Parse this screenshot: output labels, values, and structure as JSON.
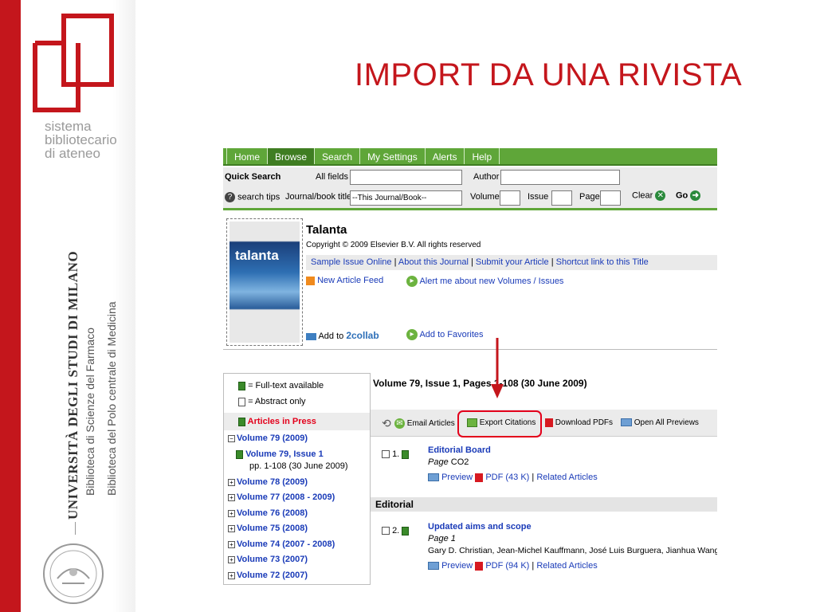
{
  "slide": {
    "title": "IMPORT DA UNA RIVISTA",
    "sistema_lines": [
      "sistema",
      "bibliotecario",
      "di ateneo"
    ],
    "university": "UNIVERSITÀ DEGLI STUDI DI MILANO",
    "library1": "Biblioteca di Scienze del Farmaco",
    "library2": "Biblioteca del Polo centrale di Medicina",
    "brand_red": "#c4161c"
  },
  "nav": {
    "tabs": [
      "Home",
      "Browse",
      "Search",
      "My Settings",
      "Alerts",
      "Help"
    ],
    "active": "Browse",
    "color": "#5fa639"
  },
  "search": {
    "quick_search": "Quick Search",
    "all_fields": "All fields",
    "author": "Author",
    "search_tips": "search tips",
    "journal_label": "Journal/book title",
    "journal_value": "--This Journal/Book--",
    "volume": "Volume",
    "issue": "Issue",
    "page": "Page",
    "clear": "Clear",
    "go": "Go"
  },
  "journal": {
    "cover_word": "talanta",
    "title": "Talanta",
    "copyright": "Copyright © 2009 Elsevier B.V. All rights reserved",
    "links": [
      "Sample Issue Online",
      "About this Journal",
      "Submit your Article",
      "Shortcut link to this Title"
    ],
    "feed": "New Article Feed",
    "alert": "Alert me about new Volumes / Issues",
    "add_to": "Add to",
    "collab": "2collab",
    "favorites": "Add to Favorites"
  },
  "legend": {
    "full_text": "= Full-text available",
    "abstract": "= Abstract only",
    "in_press": "Articles in Press"
  },
  "volumes": [
    {
      "label": "Volume 79 (2009)",
      "expanded": true
    },
    {
      "label": "Volume 78 (2009)"
    },
    {
      "label": "Volume 77 (2008 - 2009)"
    },
    {
      "label": "Volume 76 (2008)"
    },
    {
      "label": "Volume 75 (2008)"
    },
    {
      "label": "Volume 74 (2007 - 2008)"
    },
    {
      "label": "Volume 73 (2007)"
    },
    {
      "label": "Volume 72 (2007)"
    }
  ],
  "current_issue": {
    "label": "Volume 79, Issue 1",
    "pages": "pp. 1-108 (30 June 2009)"
  },
  "issue_header": "Volume 79, Issue 1, Pages 1-108 (30 June 2009)",
  "toolbar": {
    "email": "Email Articles",
    "export": "Export Citations",
    "download": "Download PDFs",
    "previews": "Open All Previews",
    "highlight_color": "#e3001b"
  },
  "articles": [
    {
      "num": "1.",
      "title": "Editorial Board",
      "page": "Page",
      "page_val": "CO2",
      "preview": "Preview",
      "pdf": "PDF (43 K)",
      "related": "Related Articles"
    },
    {
      "num": "2.",
      "title": "Updated aims and scope",
      "page": "Page",
      "page_val": "1",
      "authors": "Gary D. Christian, Jean-Michel Kauffmann, José Luis Burguera, Jianhua Wang",
      "preview": "Preview",
      "pdf": "PDF (94 K)",
      "related": "Related Articles"
    }
  ],
  "section": "Editorial"
}
